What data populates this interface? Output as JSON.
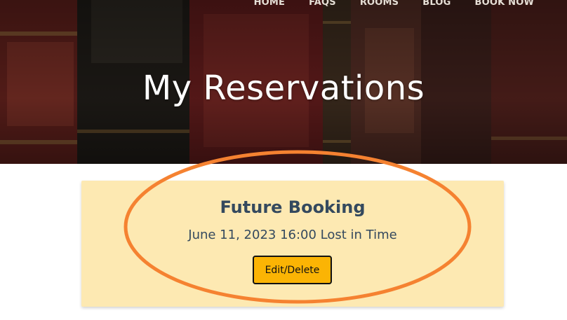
{
  "nav": {
    "items": [
      "HOME",
      "FAQS",
      "ROOMS",
      "BLOG",
      "BOOK NOW"
    ]
  },
  "hero": {
    "title": "My Reservations"
  },
  "reservation": {
    "title": "Future Booking",
    "detail": "June 11, 2023 16:00 Lost in Time",
    "button_label": "Edit/Delete"
  },
  "colors": {
    "card_background": "#fde9b2",
    "button_background": "#fbb404",
    "annotation_ellipse": "#f58231",
    "heading_text": "#34495e"
  },
  "icons": []
}
